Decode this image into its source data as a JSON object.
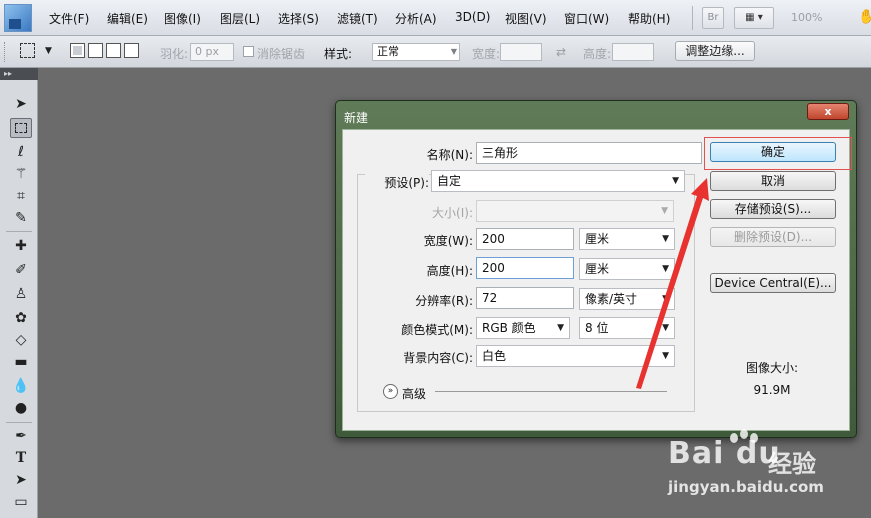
{
  "menubar": {
    "items": [
      "文件(F)",
      "编辑(E)",
      "图像(I)",
      "图层(L)",
      "选择(S)",
      "滤镜(T)",
      "分析(A)",
      "3D(D)",
      "视图(V)",
      "窗口(W)",
      "帮助(H)"
    ],
    "bridge_label": "Br",
    "zoom": "100%"
  },
  "options": {
    "feather_label": "羽化:",
    "feather_value": "0 px",
    "antialias_label": "消除锯齿",
    "style_label": "样式:",
    "style_value": "正常",
    "width_label": "宽度:",
    "height_label": "高度:",
    "refine_edge_label": "调整边缘..."
  },
  "toolbox": {
    "tools": [
      "move-tool",
      "rect-marquee-tool",
      "lasso-tool",
      "magic-wand-tool",
      "crop-tool",
      "eyedropper-tool",
      "healing-brush-tool",
      "brush-tool",
      "clone-stamp-tool",
      "history-brush-tool",
      "eraser-tool",
      "gradient-tool",
      "blur-tool",
      "dodge-tool",
      "pen-tool",
      "type-tool",
      "path-selection-tool",
      "shape-tool"
    ],
    "active_tool": "rect-marquee-tool"
  },
  "dialog": {
    "title": "新建",
    "close_label": "x",
    "name_label": "名称(N):",
    "name_value": "三角形",
    "preset_label": "预设(P):",
    "preset_value": "自定",
    "size_label": "大小(I):",
    "width_label": "宽度(W):",
    "width_value": "200",
    "width_unit": "厘米",
    "height_label": "高度(H):",
    "height_value": "200",
    "height_unit": "厘米",
    "resolution_label": "分辨率(R):",
    "resolution_value": "72",
    "resolution_unit": "像素/英寸",
    "color_mode_label": "颜色模式(M):",
    "color_mode_value": "RGB 颜色",
    "bit_depth_value": "8 位",
    "background_label": "背景内容(C):",
    "background_value": "白色",
    "advanced_label": "高级",
    "buttons": {
      "ok": "确定",
      "cancel": "取消",
      "save_preset": "存储预设(S)...",
      "delete_preset": "删除预设(D)...",
      "device_central": "Device Central(E)..."
    },
    "image_size_label": "图像大小:",
    "image_size_value": "91.9M"
  },
  "watermark": {
    "logo_text": "Bai du",
    "jingyan": "经验",
    "url": "jingyan.baidu.com"
  },
  "colors": {
    "annotation_red": "#e8322f",
    "dialog_frame": "#4e6a48",
    "primary_button": "#bee6fd"
  }
}
